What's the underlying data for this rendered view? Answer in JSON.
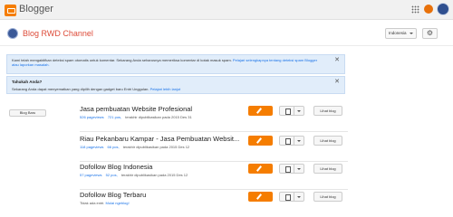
{
  "app": {
    "brand": "Blogger"
  },
  "header": {
    "blog_title": "Blog RWD Channel",
    "language": "Indonesia"
  },
  "notices": [
    {
      "text": "Kami telah mengaktifkan deteksi spam otomatis untuk komentar. Sekarang Anda seharusnya memeriksa komentar di kotak masuk spam.",
      "link": "Pelajari selengkapnya tentang deteksi spam Blogger atau laporkan masalah."
    },
    {
      "title": "Tahukah Anda?",
      "text": "Sekarang Anda dapat menyematkan yang dipilih dengan gadget baru Entri Unggulan.",
      "link": "Pelajari lebih lanjut"
    }
  ],
  "new_blog_label": "Blog Baru",
  "actions": {
    "view_label": "Lihat blog"
  },
  "blogs": [
    {
      "name": "Jasa pembuatan Website Profesional",
      "pageviews": "526 pageviews",
      "posts": "721 pos,",
      "status": "terakhir dipublikasikan pada 2015 Des 31"
    },
    {
      "name": "Riau Pekanbaru Kampar - Jasa Pembuatan Websit...",
      "pageviews": "118 pageviews",
      "posts": "66 pos,",
      "status": "terakhir dipublikasikan pada 2015 Des 12"
    },
    {
      "name": "Dofollow Blog Indonesia",
      "pageviews": "57 pageviews",
      "posts": "52 pos,",
      "status": "terakhir dipublikasikan pada 2015 Des 12"
    },
    {
      "name": "Dofollow Blog Terbaru",
      "pageviews": "",
      "posts": "Tidak ada entri.",
      "status": "Mulai ngeblog!"
    }
  ]
}
